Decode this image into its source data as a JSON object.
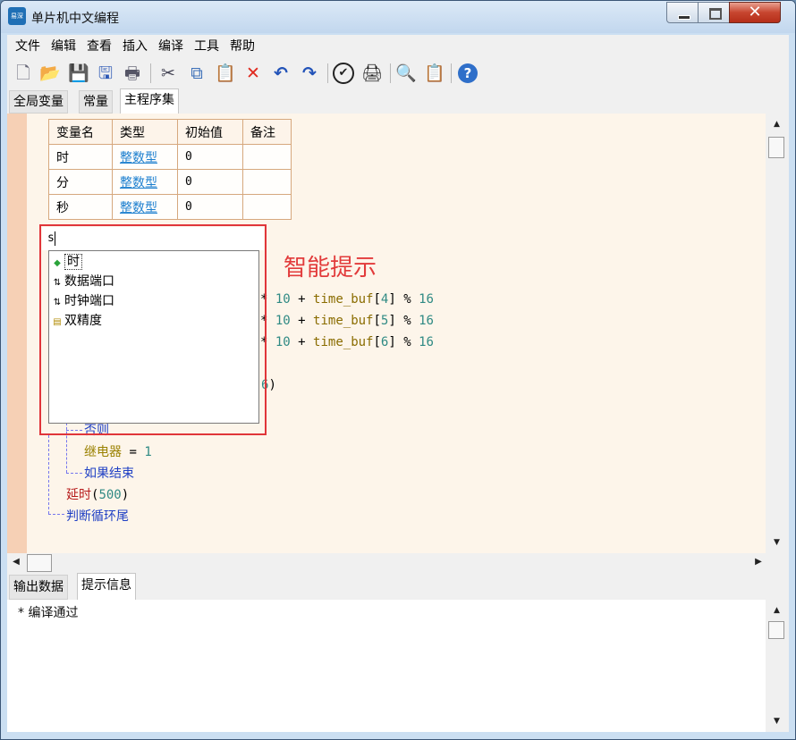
{
  "window": {
    "title": "单片机中文编程",
    "app_icon_label": "易深 YiShen",
    "close_glyph": "✕"
  },
  "menu": [
    "文件",
    "编辑",
    "查看",
    "插入",
    "编译",
    "工具",
    "帮助"
  ],
  "toolbar": [
    {
      "name": "new-file-icon",
      "glyph": "🗋"
    },
    {
      "name": "open-folder-icon",
      "glyph": "📂"
    },
    {
      "name": "save-icon",
      "glyph": "💾"
    },
    {
      "name": "save-all-icon",
      "glyph": "🖫"
    },
    {
      "name": "print-icon",
      "glyph": "🖶"
    },
    {
      "name": "cut-icon",
      "glyph": "✂"
    },
    {
      "name": "copy-icon",
      "glyph": "⧉"
    },
    {
      "name": "paste-icon",
      "glyph": "📋"
    },
    {
      "name": "delete-icon",
      "glyph": "✕"
    },
    {
      "name": "undo-icon",
      "glyph": "↶"
    },
    {
      "name": "redo-icon",
      "glyph": "↷"
    },
    {
      "name": "check-icon",
      "glyph": "✔"
    },
    {
      "name": "download-icon",
      "glyph": "🖨"
    },
    {
      "name": "find-icon",
      "glyph": "🔍"
    },
    {
      "name": "clipboard-icon",
      "glyph": "📋"
    },
    {
      "name": "help-icon",
      "glyph": "?"
    }
  ],
  "tabs": [
    "全局变量",
    "常量",
    "主程序集"
  ],
  "vartable": {
    "headers": [
      "变量名",
      "类型",
      "初始值",
      "备注"
    ],
    "rows": [
      {
        "name": "时",
        "type": "整数型",
        "init": "0",
        "note": ""
      },
      {
        "name": "分",
        "type": "整数型",
        "init": "0",
        "note": ""
      },
      {
        "name": "秒",
        "type": "整数型",
        "init": "0",
        "note": ""
      }
    ]
  },
  "code": {
    "line1": {
      "op1": "*",
      "n10": "10",
      "plus": "+",
      "id": "time_buf",
      "idx": "4",
      "mod": "%",
      "n16": "16"
    },
    "line2": {
      "op1": "*",
      "n10": "10",
      "plus": "+",
      "id": "time_buf",
      "idx": "5",
      "mod": "%",
      "n16": "16"
    },
    "line3": {
      "op1": "*",
      "n10": "10",
      "plus": "+",
      "id": "time_buf",
      "idx": "6",
      "mod": "%",
      "n16": "16"
    },
    "line4": {
      "tail_num": "6",
      "tail_paren": ")"
    },
    "else_kw": "否则",
    "relay": "继电器",
    "assign": "=",
    "relay_val": "1",
    "end_if": "如果结束",
    "delay_fn": "延时",
    "delay_arg": "500",
    "loop_end": "判断循环尾"
  },
  "autocomplete": {
    "input": "s",
    "hint_label": "智能提示",
    "items": [
      {
        "label": "时",
        "icon": "◆",
        "color": "#2aa33a"
      },
      {
        "label": "数据端口",
        "icon": "⇅",
        "color": "#333"
      },
      {
        "label": "时钟端口",
        "icon": "⇅",
        "color": "#333"
      },
      {
        "label": "双精度",
        "icon": "▤",
        "color": "#b08a00"
      }
    ]
  },
  "bottom_tabs": [
    "输出数据",
    "提示信息"
  ],
  "output": {
    "line": "* 编译通过"
  }
}
